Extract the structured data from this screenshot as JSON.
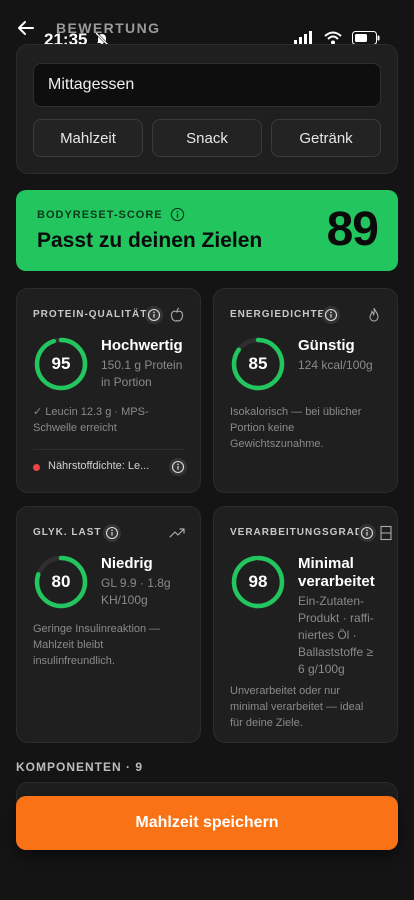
{
  "status_bar": {
    "time": "21:35"
  },
  "header": {
    "title": "BEWERTUNG"
  },
  "meal": {
    "name_value": "Mittagessen",
    "types": [
      "Mahlzeit",
      "Snack",
      "Getränk"
    ]
  },
  "score": {
    "label": "BODYRESET-SCORE",
    "headline": "Passt zu deinen Zielen",
    "value": "89",
    "color": "#22c55e"
  },
  "metrics": {
    "protein": {
      "label": "PROTEIN-QUALITÄT",
      "score": "95",
      "score_fraction": 0.95,
      "title": "Hochwertig",
      "sub_1": "150.1 g Protein",
      "sub_2": "in Portion",
      "note_1": "✓ Leucin 12.3 g · MPS-",
      "note_2": "Schwelle erreicht",
      "nutrient_line": "Nährstoffdichte: Le...",
      "icon": "apple-icon"
    },
    "energy": {
      "label": "ENERGIEDICHTE",
      "score": "85",
      "score_fraction": 0.85,
      "title": "Günstig",
      "sub_1": "124 kcal/100g",
      "note_1": "Isokalorisch — bei üblicher",
      "note_2": "Portion keine",
      "note_3": "Gewichtszunahme.",
      "icon": "flame-icon"
    },
    "glycemic": {
      "label": "GLYK. LAST",
      "score": "80",
      "score_fraction": 0.8,
      "title": "Niedrig",
      "sub_1": "GL 9.9 · 1.8g",
      "sub_2": "KH/100g",
      "note_1": "Geringe Insulinreaktion —",
      "note_2": "Mahlzeit bleibt",
      "note_3": "insulinfreundlich.",
      "icon": "trending-up-icon"
    },
    "processing": {
      "label": "VERARBEITUNGSGRAD",
      "score": "98",
      "score_fraction": 0.98,
      "title_1": "Minimal",
      "title_2": "verarbeitet",
      "sub_1": "Ein-Zutaten-",
      "sub_2": "Produkt · raffi-",
      "sub_3": "niertes Öl ·",
      "sub_4": "Ballaststoffe ≥",
      "sub_5": "6 g/100g",
      "note_1": "Unverarbeitet oder nur",
      "note_2": "minimal verarbeitet — ideal",
      "note_3": "für deine Ziele.",
      "icon": "factory-icon"
    }
  },
  "components": {
    "label": "KOMPONENTEN · 9"
  },
  "actions": {
    "save_label": "Mahlzeit speichern"
  },
  "colors": {
    "accent_green": "#22c55e",
    "accent_orange": "#f97316",
    "warning_red": "#ef4444"
  }
}
